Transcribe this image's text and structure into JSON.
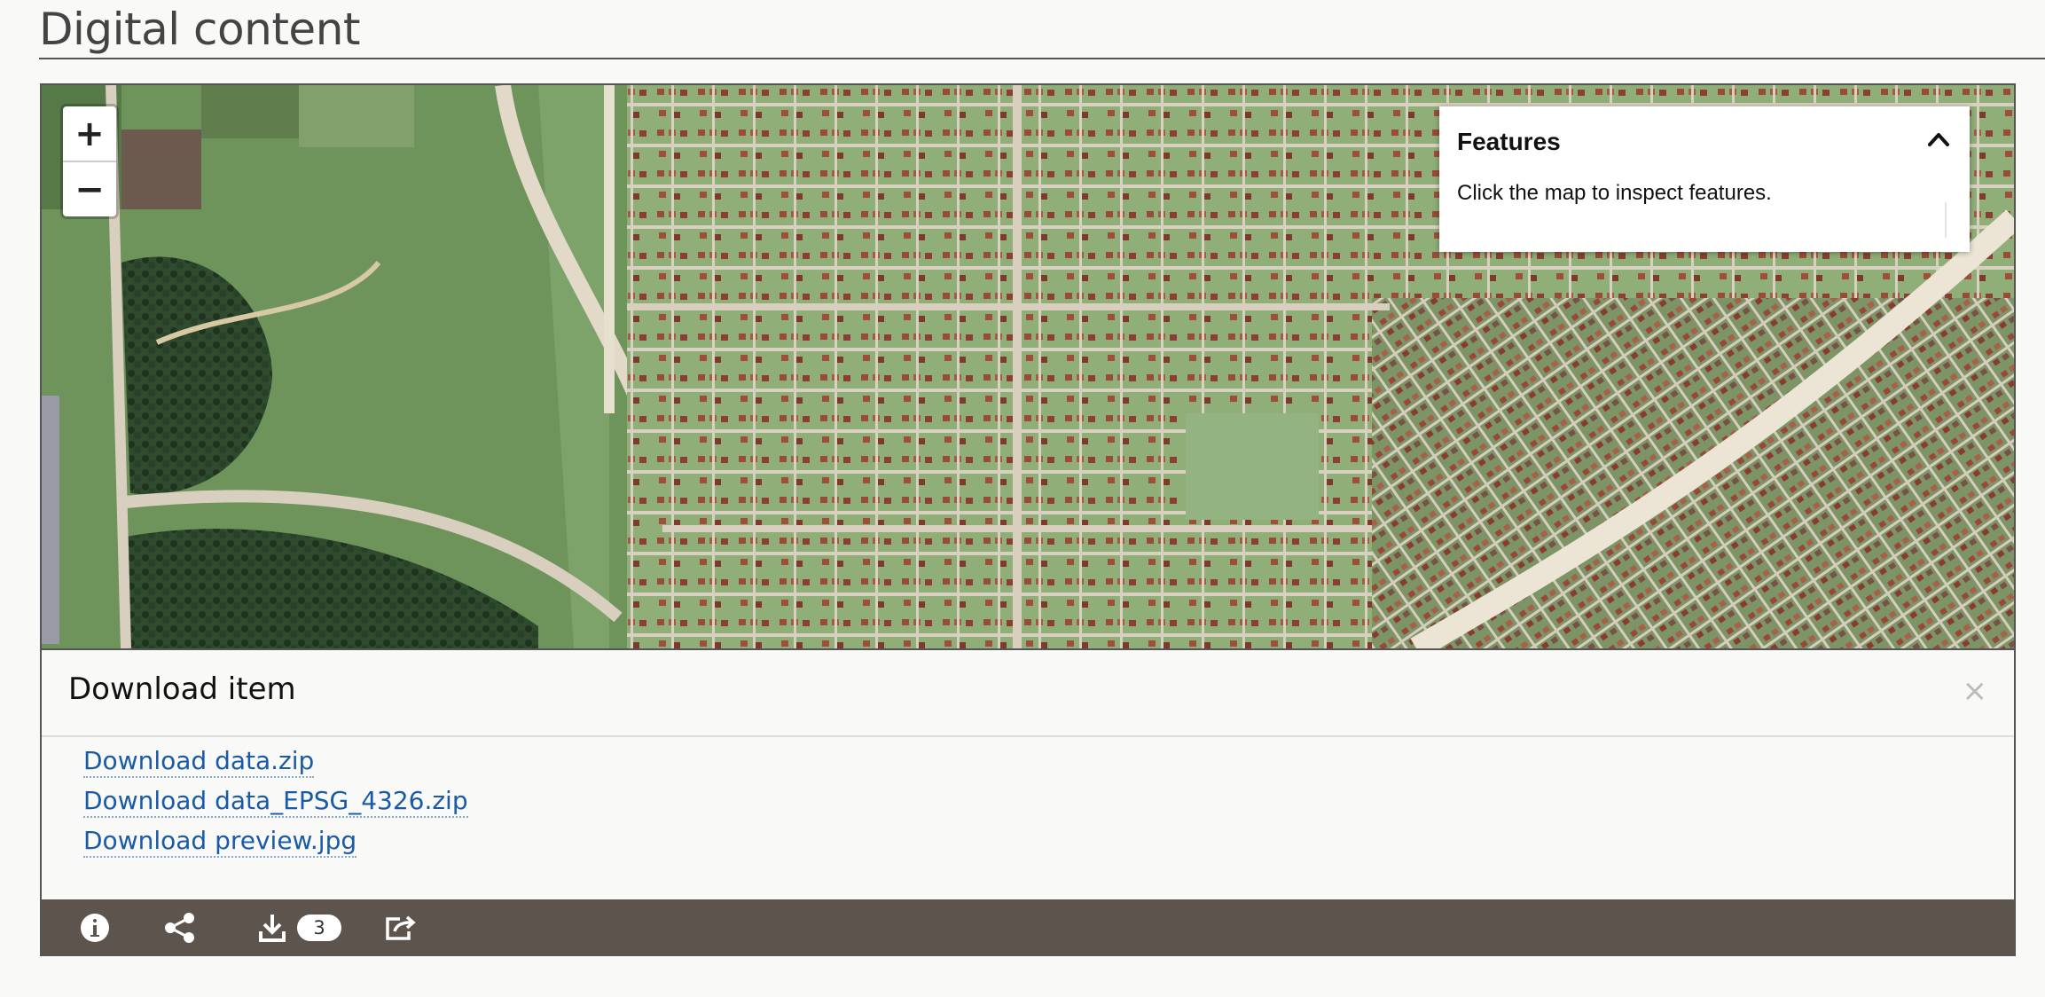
{
  "page": {
    "title": "Digital content"
  },
  "map": {
    "zoom_in_label": "+",
    "zoom_out_label": "−",
    "features_panel": {
      "title": "Features",
      "hint": "Click the map to inspect features."
    }
  },
  "download": {
    "title": "Download item",
    "close_label": "×",
    "links": [
      {
        "label": "Download data.zip"
      },
      {
        "label": "Download data_EPSG_4326.zip"
      },
      {
        "label": "Download preview.jpg"
      }
    ]
  },
  "toolbar": {
    "items": [
      {
        "icon": "info-icon"
      },
      {
        "icon": "share-icon"
      },
      {
        "icon": "download-icon",
        "badge": "3"
      },
      {
        "icon": "external-share-icon"
      }
    ],
    "background_color": "#5d544d"
  },
  "colors": {
    "link": "#1a5ba8",
    "accent_rule": "#555555"
  }
}
